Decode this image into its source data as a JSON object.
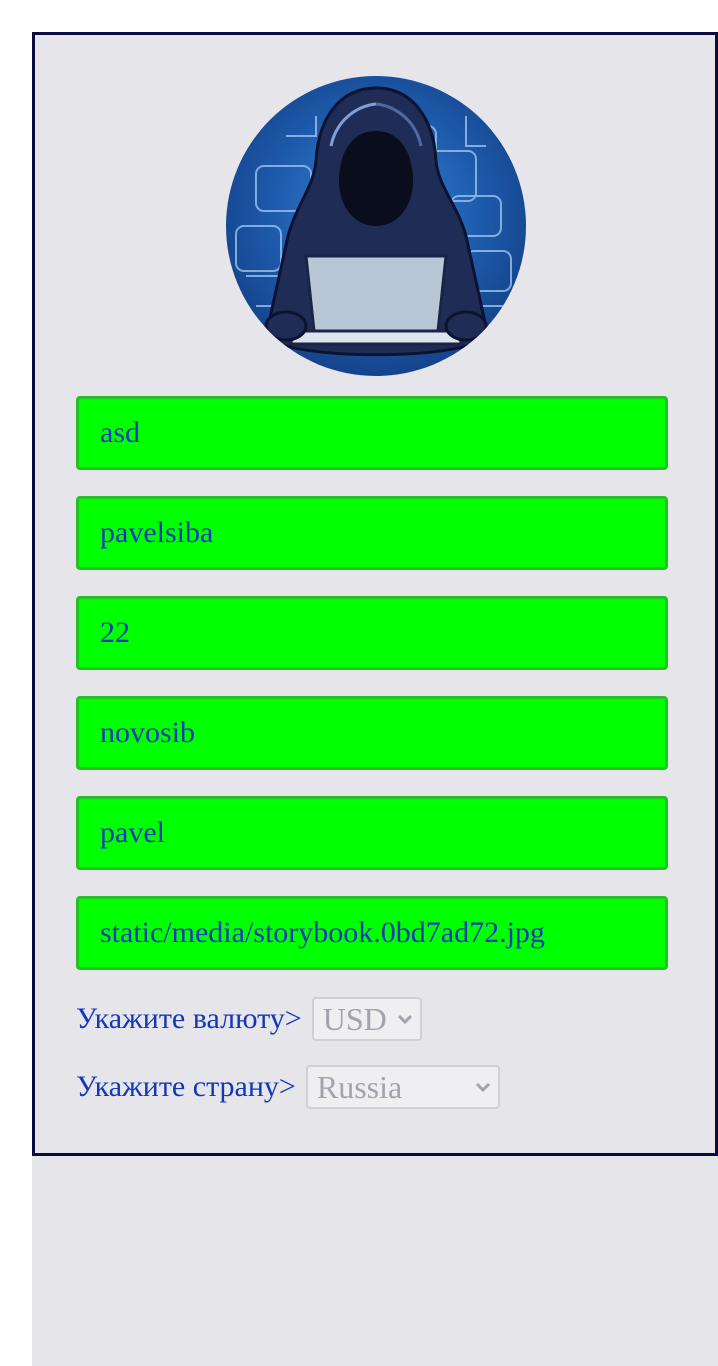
{
  "profile": {
    "fields": [
      {
        "value": "asd"
      },
      {
        "value": "pavelsiba"
      },
      {
        "value": "22"
      },
      {
        "value": "novosib"
      },
      {
        "value": "pavel"
      },
      {
        "value": "static/media/storybook.0bd7ad72.jpg"
      }
    ],
    "currency": {
      "label": "Укажите валюту>",
      "selected": "USD"
    },
    "country": {
      "label": "Укажите страну>",
      "selected": "Russia"
    },
    "avatar_icon": "hooded-hacker-avatar"
  },
  "colors": {
    "field_bg": "#00ff00",
    "field_border": "#22c222",
    "text": "#1238b8",
    "card_border": "#0b0b3f",
    "card_bg": "#e6e6ea"
  }
}
